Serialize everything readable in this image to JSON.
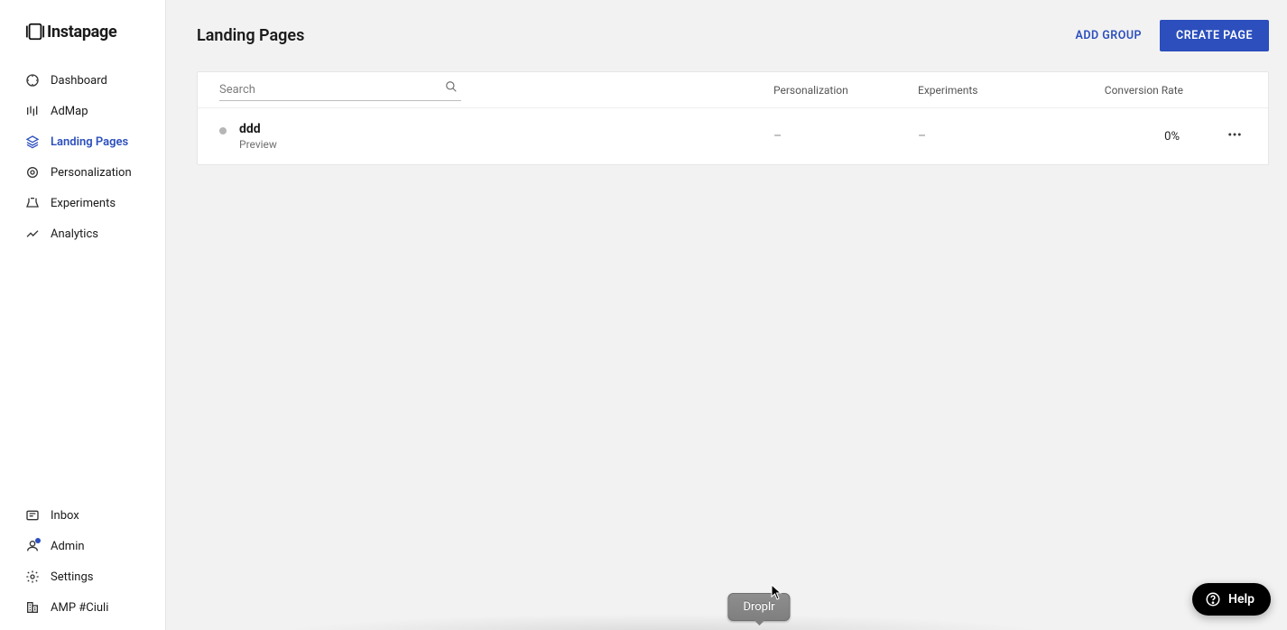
{
  "brand": "Instapage",
  "nav": {
    "dashboard": "Dashboard",
    "admap": "AdMap",
    "landing_pages": "Landing Pages",
    "personalization": "Personalization",
    "experiments": "Experiments",
    "analytics": "Analytics",
    "inbox": "Inbox",
    "admin": "Admin",
    "settings": "Settings",
    "workspace": "AMP #Ciuli"
  },
  "page": {
    "title": "Landing Pages",
    "add_group_label": "ADD GROUP",
    "create_page_label": "CREATE PAGE"
  },
  "search": {
    "placeholder": "Search"
  },
  "columns": {
    "personalization": "Personalization",
    "experiments": "Experiments",
    "conversion": "Conversion Rate"
  },
  "rows": [
    {
      "title": "ddd",
      "subtitle": "Preview",
      "personalization": "–",
      "experiments": "–",
      "conversion": "0%"
    }
  ],
  "tooltip": "Droplr",
  "help_label": "Help"
}
